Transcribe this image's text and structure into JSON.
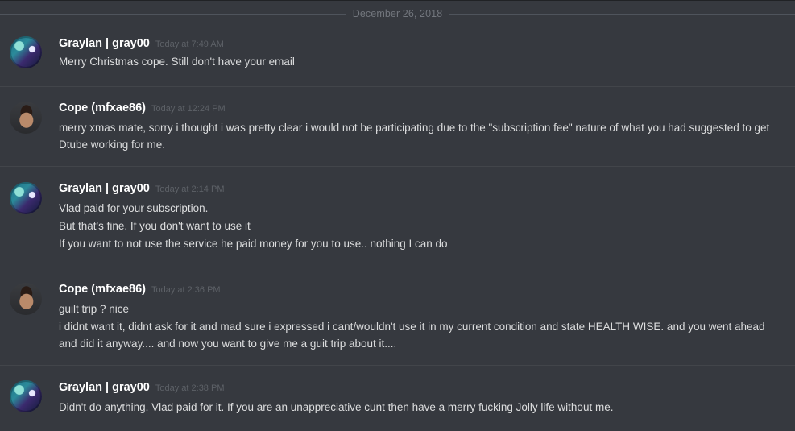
{
  "date_divider": "December 26, 2018",
  "messages": [
    {
      "author": "Graylan | gray00",
      "time": "Today at 7:49 AM",
      "avatar": "graylan-avatar",
      "lines": [
        "Merry Christmas cope. Still don't have your email"
      ]
    },
    {
      "author": "Cope (mfxae86)",
      "time": "Today at 12:24 PM",
      "avatar": "cope-avatar",
      "lines": [
        "merry xmas mate, sorry i thought i was pretty clear i would not be participating due to the \"subscription fee\" nature of what you had suggested to get Dtube working for me."
      ]
    },
    {
      "author": "Graylan | gray00",
      "time": "Today at 2:14 PM",
      "avatar": "graylan-avatar",
      "lines": [
        "Vlad paid for your subscription.",
        "But that's fine. If you don't want to use it",
        "If you want to not use the service he paid money for you to use.. nothing I can do"
      ]
    },
    {
      "author": "Cope (mfxae86)",
      "time": "Today at 2:36 PM",
      "avatar": "cope-avatar",
      "lines": [
        "guilt trip ? nice",
        "i didnt want it, didnt ask for it and mad sure i expressed i cant/wouldn't use it in my current condition and state HEALTH WISE. and you went ahead and did it anyway.... and now you want to give me a guit trip about it...."
      ]
    },
    {
      "author": "Graylan | gray00",
      "time": "Today at 2:38 PM",
      "avatar": "graylan-avatar",
      "lines": [
        "Didn't do anything. Vlad paid for it. If you are an unappreciative cunt then have a merry fucking Jolly life without me."
      ]
    }
  ]
}
